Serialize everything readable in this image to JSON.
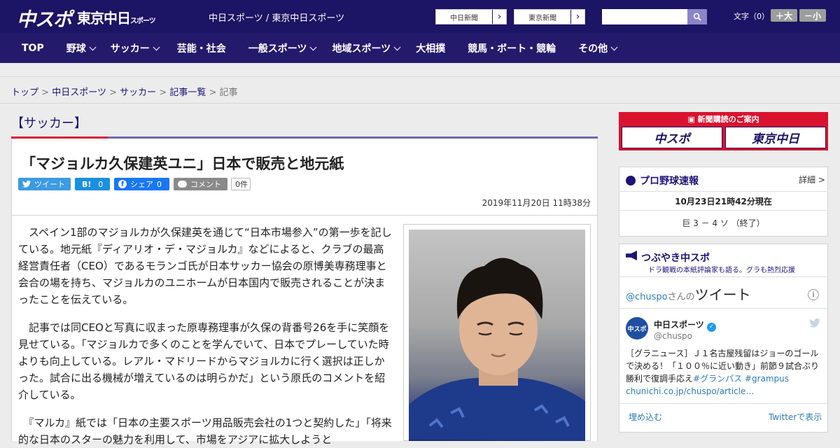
{
  "header": {
    "logo_main": "中スポ",
    "logo_tokyo": "東京中日",
    "logo_tokyo_sub": "スポーツ",
    "site_label": "中日スポーツ / 東京中日スポーツ",
    "paper_links": [
      "中日新聞",
      "東京新聞"
    ],
    "search_value": "",
    "font_size_label": "文字（0）",
    "font_bigger": "＋大",
    "font_smaller": "－小"
  },
  "nav": [
    {
      "label": "TOP",
      "dropdown": false
    },
    {
      "label": "野球",
      "dropdown": true
    },
    {
      "label": "サッカー",
      "dropdown": true
    },
    {
      "label": "芸能・社会",
      "dropdown": false
    },
    {
      "label": "一般スポーツ",
      "dropdown": true
    },
    {
      "label": "地域スポーツ",
      "dropdown": true
    },
    {
      "label": "大相撲",
      "dropdown": false
    },
    {
      "label": "競馬・ボート・競輪",
      "dropdown": false
    },
    {
      "label": "その他",
      "dropdown": true
    }
  ],
  "breadcrumb": {
    "items": [
      "トップ",
      "中日スポーツ",
      "サッカー",
      "記事一覧"
    ],
    "separator": ">",
    "current": "記事"
  },
  "article": {
    "category": "【サッカー】",
    "title": "「マジョルカ久保建英ユニ」日本で販売と地元紙",
    "social": {
      "tweet": "ツイート",
      "hatena": "B!",
      "hatena_count": "0",
      "facebook": "シェア",
      "facebook_count": "0",
      "comment": "コメント",
      "comment_count": "0件"
    },
    "date": "2019年11月20日 11時38分",
    "paragraphs": [
      "　スペイン1部のマジョルカが久保建英を通じて“日本市場参入”の第一歩を記している。地元紙『ディアリオ・デ・マジョルカ』などによると、クラブの最高経営責任者（CEO）であるモランゴ氏が日本サッカー協会の原博美専務理事と会合の場を持ち、マジョルカのユニホームが日本国内で販売されることが決まったことを伝えている。",
      "　記事では同CEOと写真に収まった原専務理事が久保の背番号26を手に笑顔を見せている。「マジョルカで多くのことを学んでいて、日本でプレーしていた時よりも向上している。レアル・マドリードからマジョルカに行く選択は正しかった。試合に出る機械が増えているのは明らかだ」という原氏のコメントを紹介している。",
      "　『マルカ』紙では「日本の主要スポーツ用品販売会社の1つと契約した」「将来的な日本のスターの魅力を利用して、市場をアジアに拡大しようと"
    ]
  },
  "sidebar": {
    "ad": {
      "title": "新聞購読のご案内",
      "buttons": [
        "中スポ",
        "東京中日"
      ]
    },
    "baseball": {
      "title": "プロ野球速報",
      "detail": "詳細 >",
      "time": "10月23日21時42分現在",
      "score": "巨 3 － 4 ソ （終了）"
    },
    "twitter": {
      "title": "つぶやき中スポ",
      "subtitle": "ドラ観戦の本紙評論家も語る。グラも熱烈応援",
      "account_prefix": "@chuspo",
      "account_suffix": "さんの",
      "tweets_label": "ツイート",
      "avatar_text": "中スポ",
      "user_name": "中日スポーツ",
      "user_handle": "@chuspo",
      "tweet_text": "［グラニュース］Ｊ１名古屋残留はジョーのゴールで決める！「１００％に近い動き」前節９試合ぶり勝利で復調手応え",
      "tweet_tags": "#グランパス #grampus",
      "tweet_link": "chunichi.co.jp/chuspo/article…",
      "embed": "埋め込む",
      "show_on_twitter": "Twitterで表示"
    }
  },
  "colors": {
    "header_bg": "#1c1464",
    "nav_bg": "#241a6c",
    "accent_red": "#d91f3a",
    "link": "#1c1478",
    "twitter_blue": "#2b7bb9"
  }
}
